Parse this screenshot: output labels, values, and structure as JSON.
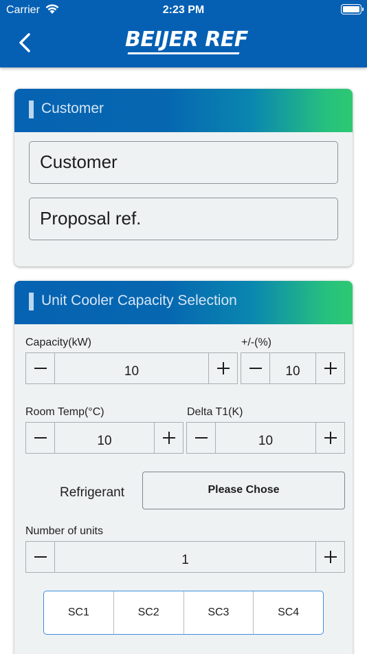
{
  "status_bar": {
    "carrier": "Carrier",
    "time": "2:23 PM"
  },
  "header": {
    "brand": "BEIJER REF",
    "back_icon": "chevron-left-icon"
  },
  "customer_card": {
    "title": "Customer",
    "customer_placeholder": "Customer",
    "proposal_placeholder": "Proposal ref."
  },
  "unit_card": {
    "title": "Unit Cooler Capacity Selection",
    "capacity": {
      "label": "Capacity(kW)",
      "value": "10"
    },
    "tolerance": {
      "label": "+/-(%)",
      "value": "10"
    },
    "room_temp": {
      "label": "Room Temp(°C)",
      "value": "10"
    },
    "delta_t1": {
      "label": "Delta T1(K)",
      "value": "10"
    },
    "refrigerant": {
      "label": "Refrigerant",
      "button": "Please Chose"
    },
    "units": {
      "label": "Number of units",
      "value": "1"
    },
    "segments": [
      "SC1",
      "SC2",
      "SC3",
      "SC4"
    ]
  },
  "colors": {
    "header_blue": "#0560b4",
    "card_gradient_start": "#0662b2",
    "card_gradient_end": "#2ec972",
    "segment_border": "#3b8fe0",
    "card_background": "#eff2f3"
  }
}
